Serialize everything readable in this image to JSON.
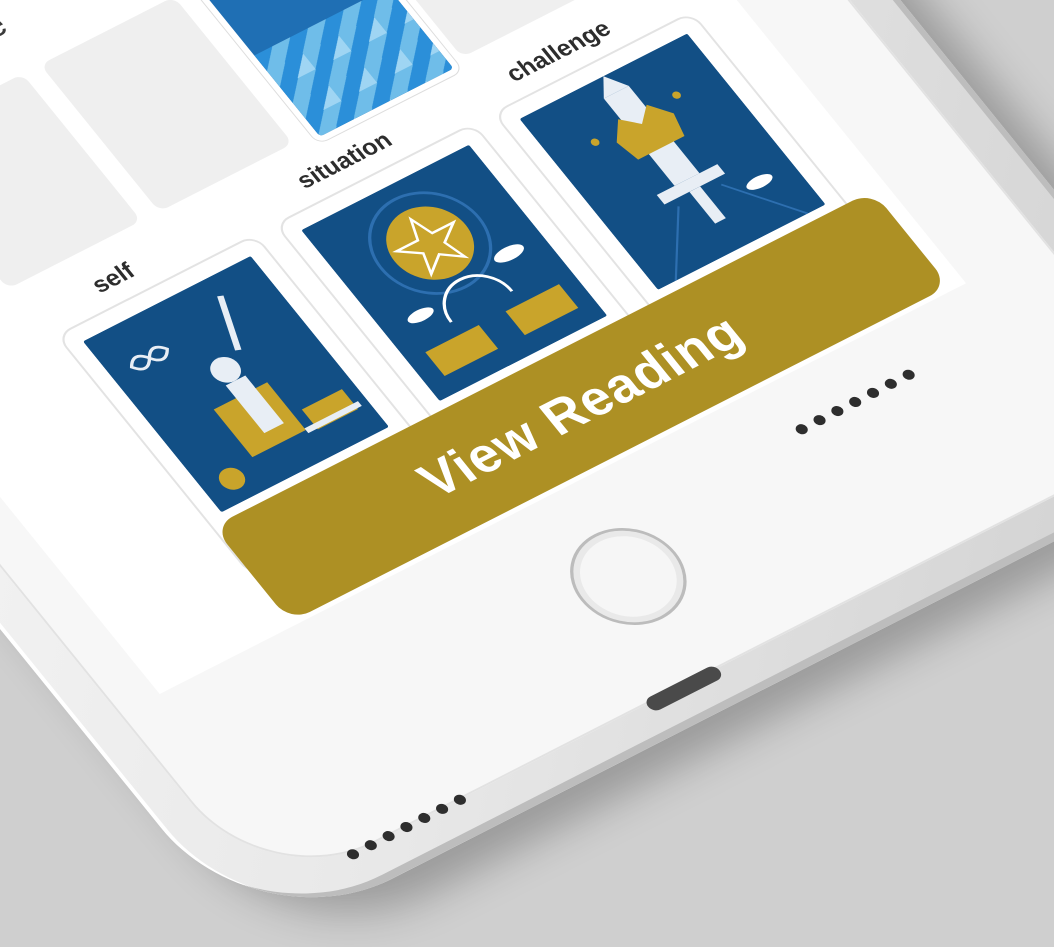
{
  "question": "“Will I ge",
  "positions": [
    "self",
    "situation",
    "challenge"
  ],
  "cards": [
    {
      "name": "The Magician"
    },
    {
      "name": "Ace of Coins"
    },
    {
      "name": "Ace of Swords"
    }
  ],
  "button": {
    "label": "View Reading"
  },
  "colors": {
    "card_blue": "#124f85",
    "card_back_blue": "#1f6fb4",
    "gold": "#c9a42b",
    "button_gold": "#ad9024",
    "background": "#cfcfcf"
  }
}
